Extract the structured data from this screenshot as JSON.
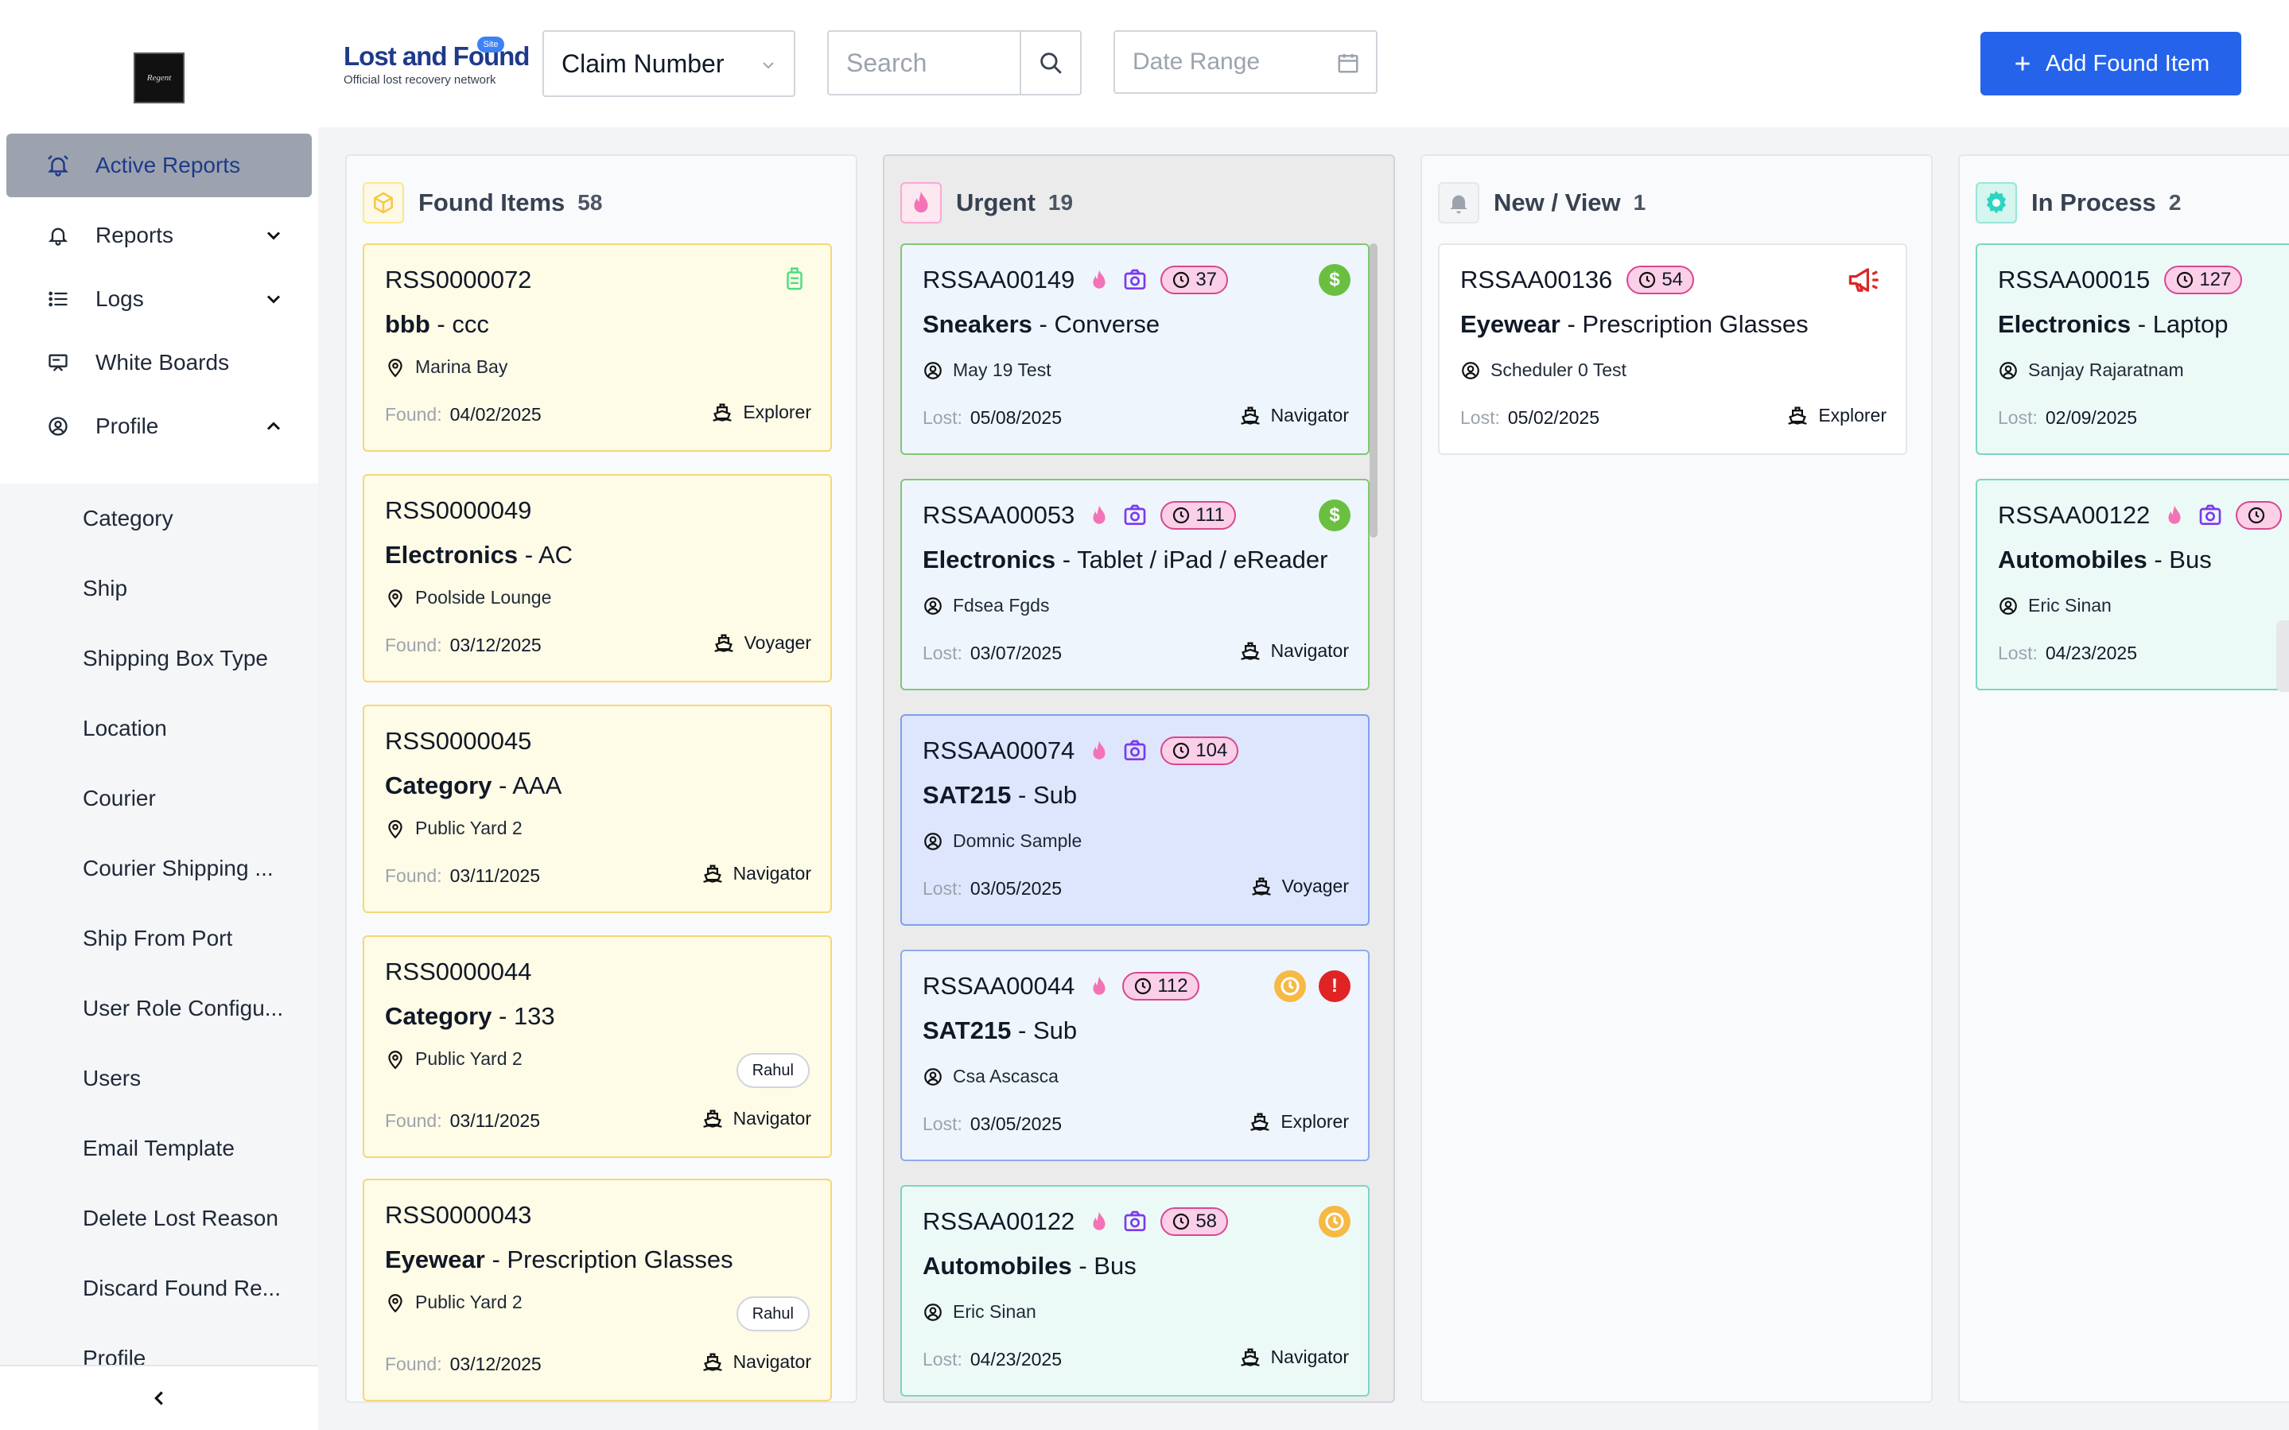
{
  "sidebar": {
    "logo_text": "Regent",
    "nav": [
      {
        "label": "Active Reports",
        "icon": "bell-ring-icon",
        "active": true
      },
      {
        "label": "Reports",
        "icon": "bell-icon",
        "expandable": "down"
      },
      {
        "label": "Logs",
        "icon": "list-icon",
        "expandable": "down"
      },
      {
        "label": "White Boards",
        "icon": "whiteboard-icon"
      },
      {
        "label": "Profile",
        "icon": "user-circle-icon",
        "expandable": "up"
      }
    ],
    "sub_items": [
      "Category",
      "Ship",
      "Shipping Box Type",
      "Location",
      "Courier",
      "Courier Shipping ...",
      "Ship From Port",
      "User Role Configu...",
      "Users",
      "Email Template",
      "Delete Lost Reason",
      "Discard Found Re...",
      "Profile"
    ],
    "collapse_icon": "chevron-left-icon"
  },
  "header": {
    "brand_name": "Lost and Found",
    "brand_tagline": "Official lost recovery network",
    "brand_badge": "Site",
    "claim_select": "Claim Number",
    "search_placeholder": "Search",
    "date_placeholder": "Date Range",
    "add_button": "Add Found Item"
  },
  "columns": [
    {
      "title": "Found Items",
      "count": "58",
      "icon": "box-icon",
      "icon_color": "#f6c94a",
      "cards": [
        {
          "claim": "RSS0000072",
          "category": "bbb",
          "sub": "ccc",
          "location": "Marina Bay",
          "date_label": "Found:",
          "date": "04/02/2025",
          "ship": "Explorer",
          "corner": "luggage-icon"
        },
        {
          "claim": "RSS0000049",
          "category": "Electronics",
          "sub": "AC",
          "location": "Poolside Lounge",
          "date_label": "Found:",
          "date": "03/12/2025",
          "ship": "Voyager"
        },
        {
          "claim": "RSS0000045",
          "category": "Category",
          "sub": "AAA",
          "location": "Public Yard 2",
          "date_label": "Found:",
          "date": "03/11/2025",
          "ship": "Navigator"
        },
        {
          "claim": "RSS0000044",
          "category": "Category",
          "sub": "133",
          "location": "Public Yard 2",
          "date_label": "Found:",
          "date": "03/11/2025",
          "ship": "Navigator",
          "chip": "Rahul"
        },
        {
          "claim": "RSS0000043",
          "category": "Eyewear",
          "sub": "Prescription Glasses",
          "location": "Public Yard 2",
          "date_label": "Found:",
          "date": "03/12/2025",
          "ship": "Navigator",
          "chip": "Rahul"
        }
      ]
    },
    {
      "title": "Urgent",
      "count": "19",
      "icon": "flame-icon",
      "icon_color": "#f472b6",
      "cards": [
        {
          "claim": "RSSAA00149",
          "age": "37",
          "category": "Sneakers",
          "sub": "Converse",
          "person": "May 19 Test",
          "date_label": "Lost:",
          "date": "05/08/2025",
          "ship": "Navigator",
          "status": [
            "dollar"
          ]
        },
        {
          "claim": "RSSAA00053",
          "age": "111",
          "category": "Electronics",
          "sub": "Tablet / iPad / eReader",
          "person": "Fdsea Fgds",
          "date_label": "Lost:",
          "date": "03/07/2025",
          "ship": "Navigator",
          "status": [
            "dollar"
          ]
        },
        {
          "claim": "RSSAA00074",
          "age": "104",
          "category": "SAT215",
          "sub": "Sub",
          "person": "Domnic Sample",
          "date_label": "Lost:",
          "date": "03/05/2025",
          "ship": "Voyager",
          "status": []
        },
        {
          "claim": "RSSAA00044",
          "age": "112",
          "category": "SAT215",
          "sub": "Sub",
          "person": "Csa Ascasca",
          "date_label": "Lost:",
          "date": "03/05/2025",
          "ship": "Explorer",
          "status": [
            "clock",
            "alert"
          ]
        },
        {
          "claim": "RSSAA00122",
          "age": "58",
          "category": "Automobiles",
          "sub": "Bus",
          "person": "Eric Sinan",
          "date_label": "Lost:",
          "date": "04/23/2025",
          "ship": "Navigator",
          "status": [
            "clock"
          ]
        }
      ]
    },
    {
      "title": "New / View",
      "count": "1",
      "icon": "bell-icon",
      "icon_color": "#9ca3af",
      "cards": [
        {
          "claim": "RSSAA00136",
          "age": "54",
          "category": "Eyewear",
          "sub": "Prescription Glasses",
          "person": "Scheduler 0 Test",
          "date_label": "Lost:",
          "date": "05/02/2025",
          "ship": "Explorer",
          "corner": "megaphone-icon"
        }
      ]
    },
    {
      "title": "In Process",
      "count": "2",
      "icon": "gear-icon",
      "icon_color": "#2dd4bf",
      "cards": [
        {
          "claim": "RSSAA00015",
          "age": "127",
          "category": "Electronics",
          "sub": "Laptop",
          "person": "Sanjay Rajaratnam",
          "date_label": "Lost:",
          "date": "02/09/2025"
        },
        {
          "claim": "RSSAA00122",
          "category": "Automobiles",
          "sub": "Bus",
          "person": "Eric Sinan",
          "date_label": "Lost:",
          "date": "04/23/2025"
        }
      ]
    }
  ]
}
